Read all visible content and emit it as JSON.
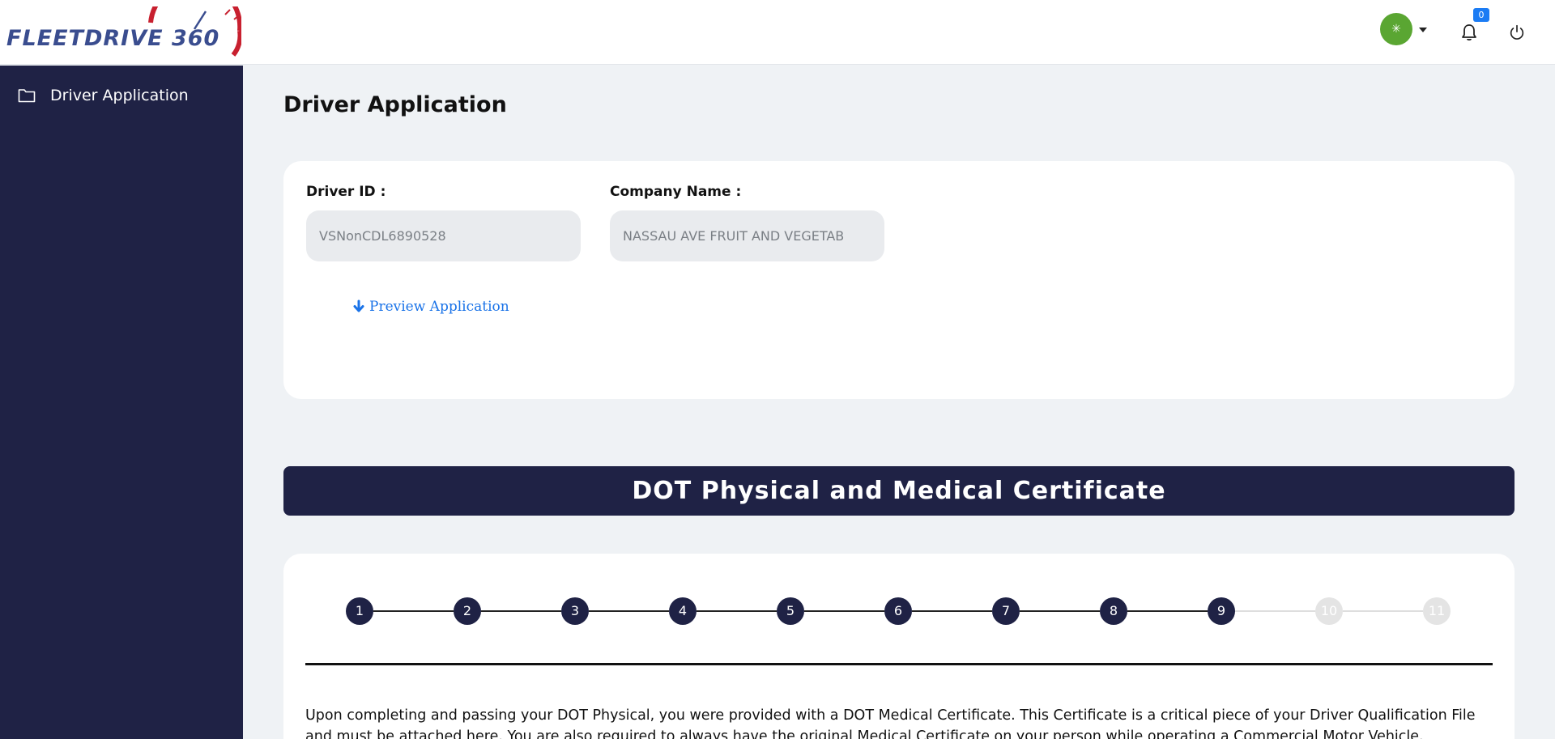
{
  "header": {
    "logo_text": "FLEETDRIVE 360",
    "avatar_symbol": "✳",
    "notification_count": "0"
  },
  "sidebar": {
    "items": [
      {
        "label": "Driver Application",
        "icon": "folder-icon"
      }
    ]
  },
  "main": {
    "page_title": "Driver Application",
    "driver_id": {
      "label": "Driver ID :",
      "value": "VSNonCDL6890528"
    },
    "company_name": {
      "label": "Company Name :",
      "value": "NASSAU AVE FRUIT AND VEGETAB"
    },
    "preview_link": "Preview Application",
    "section_title": "DOT Physical and Medical Certificate",
    "steps": [
      {
        "label": "1",
        "enabled": true
      },
      {
        "label": "2",
        "enabled": true
      },
      {
        "label": "3",
        "enabled": true
      },
      {
        "label": "4",
        "enabled": true
      },
      {
        "label": "5",
        "enabled": true
      },
      {
        "label": "6",
        "enabled": true
      },
      {
        "label": "7",
        "enabled": true
      },
      {
        "label": "8",
        "enabled": true
      },
      {
        "label": "9",
        "enabled": true
      },
      {
        "label": "10",
        "enabled": false
      },
      {
        "label": "11",
        "enabled": false
      }
    ],
    "description": "Upon completing and passing your DOT Physical, you were provided with a DOT Medical Certificate. This Certificate is a critical piece of your Driver Qualification File and must be attached here. You are also required to always have the original Medical Certificate on your person while operating a Commercial Motor Vehicle."
  },
  "colors": {
    "navy": "#1f2245",
    "brand_blue": "#3a4d8f",
    "brand_red": "#c8202f",
    "avatar_green": "#5aa632",
    "link_blue": "#1a73e8",
    "badge_blue": "#1b7cf4"
  }
}
